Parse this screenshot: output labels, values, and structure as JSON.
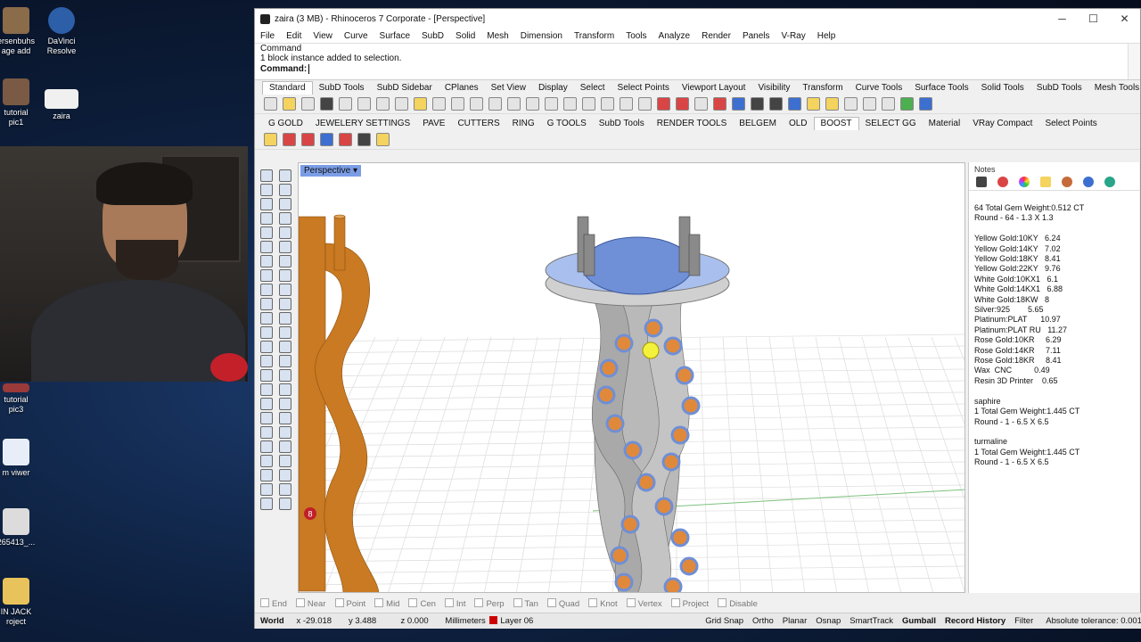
{
  "desktop": {
    "icons": [
      {
        "label": "ersenbuhs\nage add",
        "color": "#8a6b4a"
      },
      {
        "label": "DaVinci\nResolve",
        "color": "#2d5ea8"
      },
      {
        "label": "tutorial\npic1",
        "color": "#7a5a44"
      },
      {
        "label": "zaira",
        "color": "#f0f0f0"
      },
      {
        "label": "tutorial\npic3",
        "color": "#9a3a3a"
      },
      {
        "label": "m viwer",
        "color": "#e8eef8"
      },
      {
        "label": "265413_...",
        "color": "#dcdcdc"
      },
      {
        "label": "IN JACK\nroject",
        "color": "#e8c25a"
      }
    ]
  },
  "window": {
    "title": "zaira (3 MB) - Rhinoceros 7 Corporate - [Perspective]",
    "controls": [
      "─",
      "☐",
      "✕"
    ]
  },
  "menu": [
    "File",
    "Edit",
    "View",
    "Curve",
    "Surface",
    "SubD",
    "Solid",
    "Mesh",
    "Dimension",
    "Transform",
    "Tools",
    "Analyze",
    "Render",
    "Panels",
    "V-Ray",
    "Help"
  ],
  "command": {
    "history": [
      "Command",
      "1 block instance added to selection."
    ],
    "prompt": "Command:",
    "value": ""
  },
  "toolbar_tabs": {
    "items": [
      "Standard",
      "SubD Tools",
      "SubD Sidebar",
      "CPlanes",
      "Set View",
      "Display",
      "Select",
      "Select Points",
      "Viewport Layout",
      "Visibility",
      "Transform",
      "Curve Tools",
      "Surface Tools",
      "Solid Tools",
      "SubD Tools",
      "Mesh Tools",
      "Rende"
    ],
    "active": "Standard",
    "overflow": "»"
  },
  "toolbar_tabs2": {
    "items": [
      "G GOLD",
      "JEWELERY SETTINGS",
      "PAVE",
      "CUTTERS",
      "RING",
      "G TOOLS",
      "SubD Tools",
      "RENDER TOOLS",
      "BELGEM",
      "OLD",
      "BOOST",
      "SELECT GG",
      "Material",
      "VRay Compact",
      "Select Points"
    ],
    "active": "BOOST"
  },
  "viewport": {
    "label": "Perspective",
    "marker": "8"
  },
  "notes": {
    "title": "Notes",
    "lines": [
      "64 Total Gem Weight:0.512 CT",
      "Round - 64 - 1.3 X 1.3",
      "",
      "Yellow Gold:10KY   6.24",
      "Yellow Gold:14KY   7.02",
      "Yellow Gold:18KY   8.41",
      "Yellow Gold:22KY   9.76",
      "White Gold:10KX1   6.1",
      "White Gold:14KX1   6.88",
      "White Gold:18KW   8",
      "Silver:925        5.65",
      "Platinum:PLAT      10.97",
      "Platinum:PLAT RU   11.27",
      "Rose Gold:10KR     6.29",
      "Rose Gold:14KR     7.11",
      "Rose Gold:18KR     8.41",
      "Wax  CNC          0.49",
      "Resin 3D Printer    0.65",
      "",
      "saphire",
      "1 Total Gem Weight:1.445 CT",
      "Round - 1 - 6.5 X 6.5",
      "",
      "turmaline",
      "1 Total Gem Weight:1.445 CT",
      "Round - 1 - 6.5 X 6.5"
    ]
  },
  "osnap": [
    "End",
    "Near",
    "Point",
    "Mid",
    "Cen",
    "Int",
    "Perp",
    "Tan",
    "Quad",
    "Knot",
    "Vertex",
    "Project",
    "Disable"
  ],
  "status": {
    "cplane": "World",
    "x": "x -29.018",
    "y": "y 3.488",
    "z": "z 0.000",
    "units": "Millimeters",
    "layer": "Layer 06",
    "layer_color": "#cc0000",
    "toggles": [
      "Grid Snap",
      "Ortho",
      "Planar",
      "Osnap",
      "SmartTrack",
      "Gumball",
      "Record History",
      "Filter"
    ],
    "tolerance": "Absolute tolerance: 0.001"
  },
  "colors": {
    "gold": "#d98a2c",
    "metal": "#b9b9b9",
    "gem": "#7da2e8"
  }
}
